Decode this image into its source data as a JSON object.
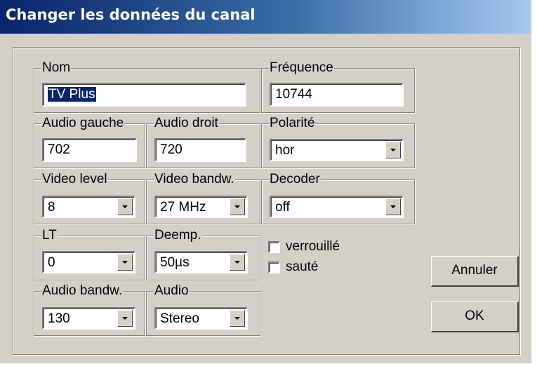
{
  "window": {
    "title": "Changer les données du canal"
  },
  "groups": {
    "nom": {
      "label": "Nom",
      "value": "TV Plus"
    },
    "frequence": {
      "label": "Fréquence",
      "value": "10744"
    },
    "audio_gauche": {
      "label": "Audio gauche",
      "value": "702"
    },
    "audio_droit": {
      "label": "Audio droit",
      "value": "720"
    },
    "polarite": {
      "label": "Polarité",
      "value": "hor"
    },
    "video_level": {
      "label": "Video level",
      "value": "8"
    },
    "video_bandw": {
      "label": "Video bandw.",
      "value": "27 MHz"
    },
    "decoder": {
      "label": "Decoder",
      "value": "off"
    },
    "lt": {
      "label": "LT",
      "value": "0"
    },
    "deemp": {
      "label": "Deemp.",
      "value": "50µs"
    },
    "audio_bandw": {
      "label": "Audio bandw.",
      "value": "130"
    },
    "audio": {
      "label": "Audio",
      "value": "Stereo"
    }
  },
  "checkboxes": {
    "verrouille": {
      "label": "verrouillé",
      "checked": false
    },
    "saute": {
      "label": "sauté",
      "checked": false
    }
  },
  "buttons": {
    "cancel": "Annuler",
    "ok": "OK"
  },
  "colors": {
    "face": "#d4d0c8",
    "title_start": "#0a246a",
    "title_end": "#a6caf0",
    "selection": "#0a246a"
  },
  "icons": {
    "dropdown": "chevron-down-icon"
  }
}
